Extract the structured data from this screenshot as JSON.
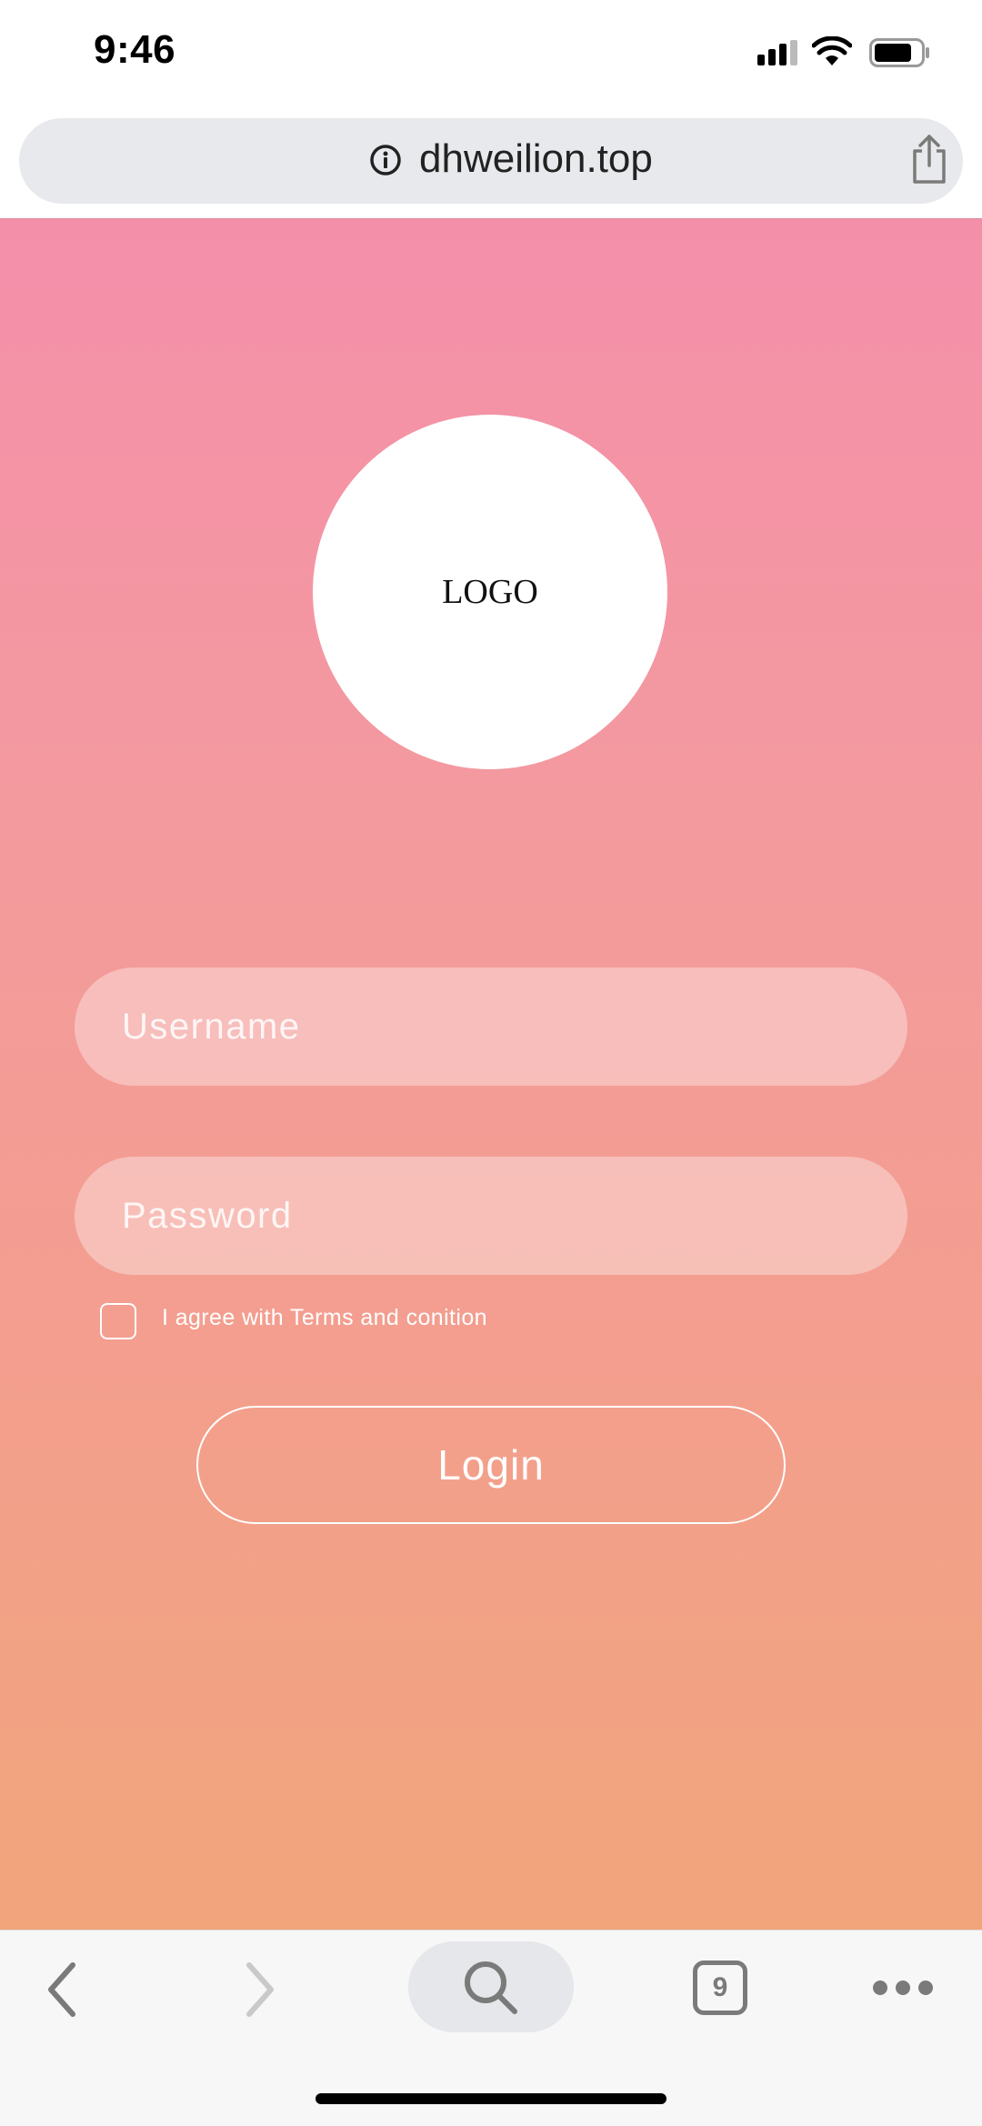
{
  "status_bar": {
    "time": "9:46"
  },
  "browser": {
    "url": "dhweilion.top",
    "tab_count": "9"
  },
  "login": {
    "logo_text": "LOGO",
    "username_placeholder": "Username",
    "password_placeholder": "Password",
    "agree_text": "I agree with Terms and conition",
    "login_label": "Login"
  },
  "colors": {
    "gradient_top": "#f48faa",
    "gradient_bottom": "#f2a57b"
  },
  "icons": {
    "status": [
      "signal-icon",
      "wifi-icon",
      "battery-icon"
    ],
    "url_bar": [
      "info-icon",
      "share-icon"
    ],
    "toolbar": [
      "back-icon",
      "forward-icon",
      "search-icon",
      "tabs-icon",
      "more-icon"
    ]
  }
}
